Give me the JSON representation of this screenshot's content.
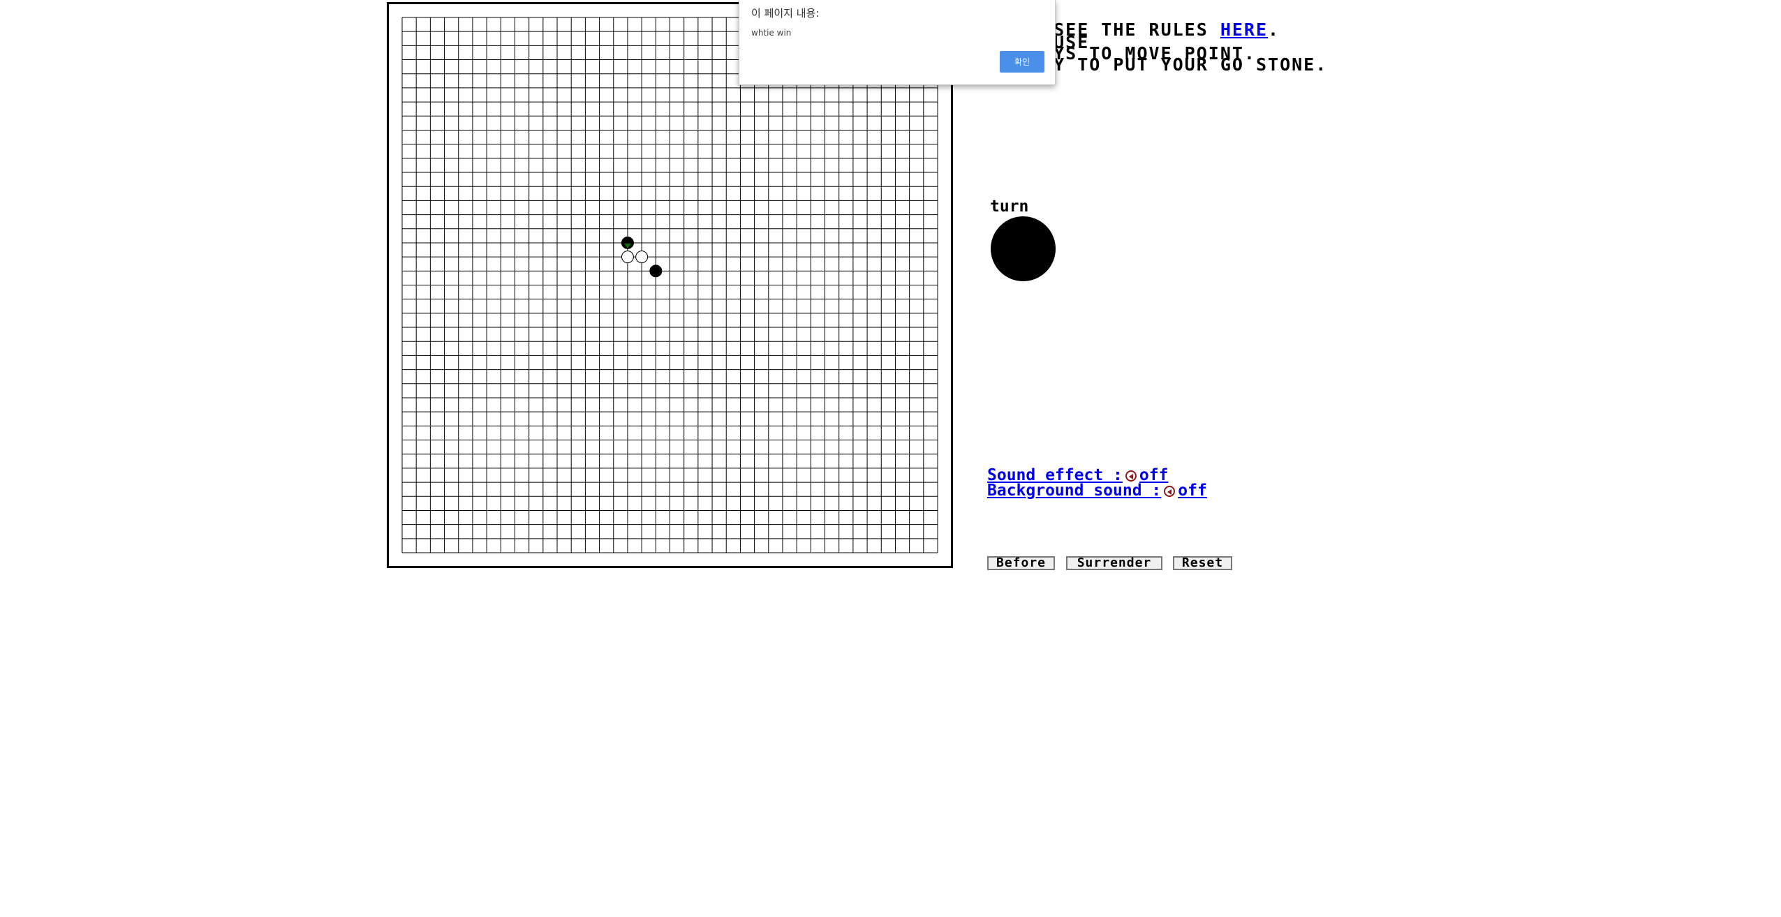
{
  "rules": {
    "line0": "!!",
    "line1_prefix": "N SEE THE RULES ",
    "link": "HERE",
    "line1_suffix": ".",
    "line2": "N USE",
    "line3": "KEYS TO MOVE POINT.",
    "line4": "KEY TO PUT YOUR GO STONE."
  },
  "turn": {
    "label": "turn",
    "stone_color": "#000000"
  },
  "sound": {
    "effect_label": "Sound effect :",
    "effect_state": "off",
    "background_label": "Background sound :",
    "background_state": "off",
    "icon": "speaker-muted-icon"
  },
  "buttons": {
    "before": "Before",
    "surrender": "Surrender",
    "reset": "Reset"
  },
  "alert": {
    "title": "이 페이지 내용:",
    "message": "whtie win",
    "ok": "확인"
  },
  "board": {
    "size": 38,
    "stones": [
      {
        "col": 16,
        "row": 16,
        "color": "black"
      },
      {
        "col": 16,
        "row": 17,
        "color": "white"
      },
      {
        "col": 17,
        "row": 17,
        "color": "white"
      },
      {
        "col": 18,
        "row": 18,
        "color": "black"
      }
    ],
    "cursor": {
      "col": 16,
      "row": 16,
      "color": "#0a6e0a"
    }
  }
}
